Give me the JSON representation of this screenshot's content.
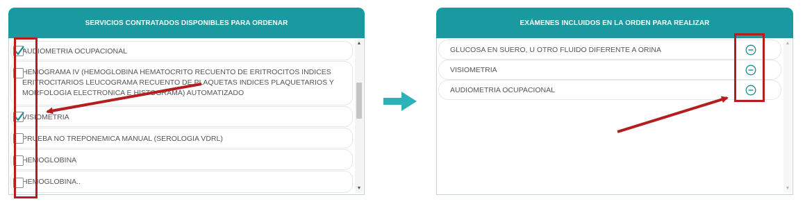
{
  "left_panel": {
    "title": "SERVICIOS CONTRATADOS DISPONIBLES PARA ORDENAR",
    "items": [
      {
        "label": "AUDIOMETRIA OCUPACIONAL",
        "checked": true
      },
      {
        "label": "HEMOGRAMA IV (HEMOGLOBINA HEMATOCRITO RECUENTO DE ERITROCITOS INDICES ERITROCITARIOS LEUCOGRAMA RECUENTO DE PLAQUETAS INDICES PLAQUETARIOS Y MORFOLOGIA ELECTRONICA E HISTOGRAMA) AUTOMATIZADO",
        "checked": false
      },
      {
        "label": "VISIOMETRIA",
        "checked": true
      },
      {
        "label": "PRUEBA NO TREPONEMICA MANUAL (SEROLOGIA VDRL)",
        "checked": false
      },
      {
        "label": "HEMOGLOBINA",
        "checked": false
      },
      {
        "label": "HEMOGLOBINA..",
        "checked": false
      }
    ]
  },
  "right_panel": {
    "title": "EXÁMENES INCLUIDOS EN LA ORDEN PARA REALIZAR",
    "items": [
      {
        "label": "GLUCOSA EN SUERO, U OTRO FLUIDO DIFERENTE A ORINA"
      },
      {
        "label": "VISIOMETRIA"
      },
      {
        "label": "AUDIOMETRIA OCUPACIONAL"
      }
    ]
  },
  "colors": {
    "header_teal": "#1a9aa0",
    "check_teal": "#1a8c94",
    "transfer_arrow": "#2bb3b8",
    "annotation_red": "#b41e1e"
  },
  "icons": {
    "checked": "checkmark-icon",
    "remove": "minus-circle-icon",
    "transfer": "arrow-right-icon",
    "scroll_up": "triangle-up-icon",
    "scroll_down": "triangle-down-icon"
  }
}
